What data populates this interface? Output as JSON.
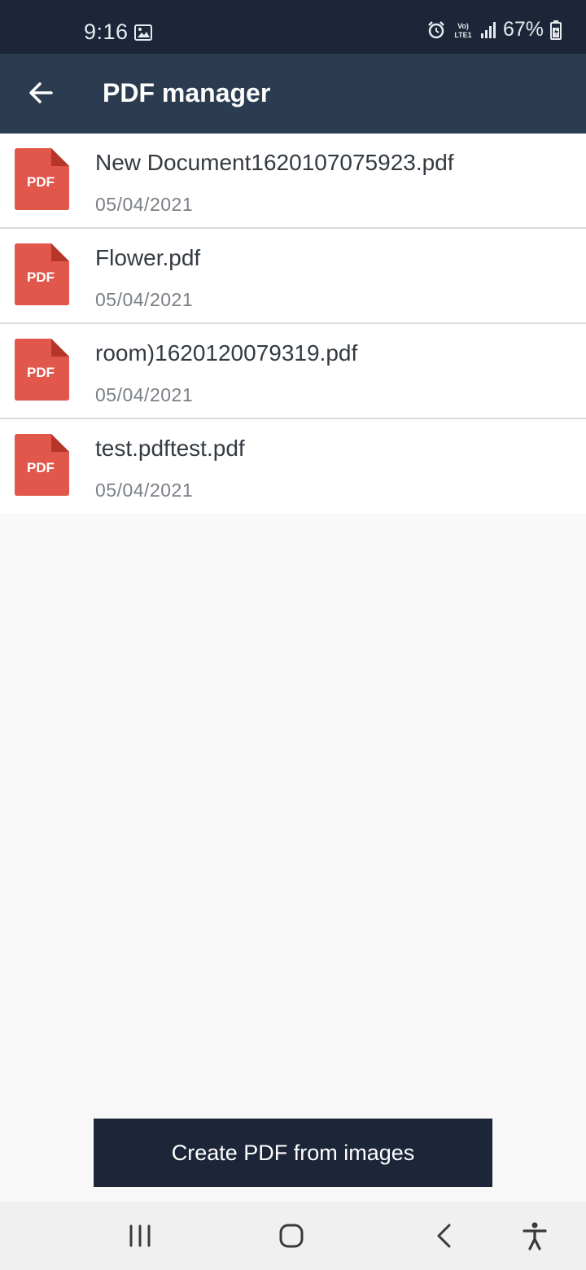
{
  "status_bar": {
    "time": "9:16",
    "battery": "67%",
    "network_label": "Vo) LTE1",
    "icons": [
      "image-icon",
      "alarm-icon",
      "volte-icon",
      "signal-icon",
      "battery-icon"
    ]
  },
  "app_bar": {
    "title": "PDF manager",
    "back_icon": "arrow-left-icon"
  },
  "files": [
    {
      "name": "New Document1620107075923.pdf",
      "date": "05/04/2021",
      "icon_label": "PDF"
    },
    {
      "name": "Flower.pdf",
      "date": "05/04/2021",
      "icon_label": "PDF"
    },
    {
      "name": "room)1620120079319.pdf",
      "date": "05/04/2021",
      "icon_label": "PDF"
    },
    {
      "name": "test.pdftest.pdf",
      "date": "05/04/2021",
      "icon_label": "PDF"
    }
  ],
  "actions": {
    "create_label": "Create PDF from images"
  },
  "nav_bar": {
    "icons": [
      "recent-apps-icon",
      "home-icon",
      "back-icon",
      "accessibility-icon"
    ]
  },
  "colors": {
    "status_bar": "#1c2638",
    "app_bar": "#2b3b50",
    "pdf_red": "#e2574c",
    "pdf_fold": "#b53629",
    "button": "#1c2638"
  }
}
